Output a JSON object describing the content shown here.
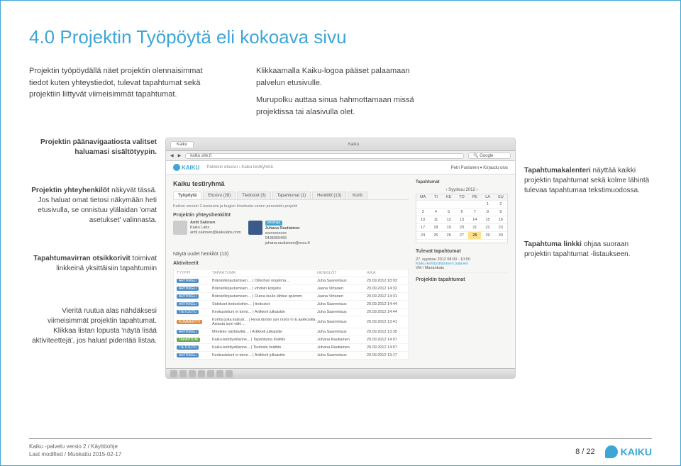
{
  "page": {
    "title": "4.0 Projektin Työpöytä eli kokoava sivu",
    "intro_left": "Projektin työpöydällä näet projektin olennaisimmat tiedot kuten yhteystiedot, tulevat tapahtumat sekä projektiin liittyvät viimeisimmät tapahtumat.",
    "intro_right1": "Klikkaamalla Kaiku-logoa pääset palaamaan palvelun etusivulle.",
    "intro_right2": "Murupolku auttaa sinua hahmottamaan missä projektissa tai alasivulla olet."
  },
  "notes": {
    "left1": "Projektin päänavigaatiosta valitset haluamasi sisältötyypin.",
    "left2_b": "Projektin yhteyhenkilöt",
    "left2": " näkyvät tässä. Jos haluat omat tietosi näkymään heti etusivulla, se onnistuu ylälaidan 'omat asetukset' valinnasta.",
    "left3_b": "Tapahtumavirran otsikkorivit",
    "left3": " toimivat linkkeinä yksittäisiin tapahtumiin",
    "left4": "Vieritä ruutua alas nähdäksesi viimeisimmät projektin tapahtumat. Klikkaa listan lopusta 'näytä lisää aktiviteettejä', jos haluat pidentää listaa.",
    "right1_b": "Tapahtumakalenteri",
    "right1": " näyttää kaikki projektin tapahtumat sekä kolme lähintä tulevaa tapahtumaa tekstimuodossa.",
    "right2_b": "Tapahtuma linkki",
    "right2": " ohjaa suoraan projektin tapahtumat -listaukseen."
  },
  "screenshot": {
    "tab_label": "Kaiku",
    "page_label": "Kaiku",
    "url": "kaiku.site.fi",
    "brand": "KAIKU",
    "breadcrumb": "Palvelun etusivu  ›  Kaiku testiryhmä",
    "user": "Petri Puolanen ▾   Kirjaudu ulos",
    "project_title": "Kaiku testiryhmä",
    "tabs": [
      "Työpöytä",
      "Etusivu (28)",
      "Tiedostot (3)",
      "Tapahtumat (1)",
      "Henkilöt (13)",
      "Kortit"
    ],
    "intro_text": "Kaikun version 2 testausta ja bugien ilmoitusta varten perustettu projekti",
    "section_contacts": "Projektin yhteyshenkilöt",
    "person1": {
      "name": "Antti Salonen",
      "org": "Kaiku Labs",
      "email": "antti.salonen@kaikulabs.com"
    },
    "person2": {
      "badge": "omistaja",
      "name": "Juhana Rautiainen",
      "org": "xxxxxxxxxxx",
      "phone": "0438365456",
      "email": "juhana.rautiainen@xxxx.fi"
    },
    "section_recent": "Näytä uudet henkilöt (13)",
    "section_activity": "Aktiviteetit",
    "act_headers": [
      "TYYPPI",
      "TAPAHTUMA",
      "HENKILÖT",
      "AIKA"
    ],
    "activities": [
      {
        "tag": "ARTIKKELI",
        "cls": "blue",
        "text": "Bränkirkirjautumisen… | Olikohan ongelma ...",
        "who": "Juha Saarentaus",
        "when": "20.09.2012 18:03"
      },
      {
        "tag": "ARTIKKELI",
        "cls": "blue",
        "text": "Bränkirkirjautumisen… | vihdoin korjattu",
        "who": "Jaana Virtanen",
        "when": "20.09.2012 14:32"
      },
      {
        "tag": "ARTIKKELI",
        "cls": "blue",
        "text": "Bränkirkirjautumisen… | Outoa kuule lähtee spämmi",
        "who": "Jaana Virtanen",
        "when": "20.09.2012 14:31"
      },
      {
        "tag": "ARTIKKELI",
        "cls": "blue",
        "text": "Sidokset tiedostoihin… | tiedostot",
        "who": "Juha Saarentaus",
        "when": "20.09.2012 14:44"
      },
      {
        "tag": "TIETOGTO",
        "cls": "blue",
        "text": "Keskusteluni ei toimi… | Artikkeli julkaistiin",
        "who": "Juha Saarentaus",
        "when": "20.09.2012 14:44"
      },
      {
        "tag": "KOMMENTTI",
        "cls": "orange",
        "text": "Korttia joita lisätud… | Hyvä tämän syn myös © & aakkosilla. Asiasta ison väki ...",
        "who": "Juha Saarentaus",
        "when": "20.09.2012 13:41"
      },
      {
        "tag": "ARTIKKELI",
        "cls": "blue",
        "text": "Mireikko näyttävillä… | Artikkeli julkaistiin",
        "who": "Juha Saarentaus",
        "when": "20.09.2012 13:35"
      },
      {
        "tag": "TAPAHTUM",
        "cls": "green",
        "text": "Kaiku-kehitystilanne... | Tapahtuma lisättiin",
        "who": "Juhana Rautiainen",
        "when": "20.09.2012 14:07"
      },
      {
        "tag": "TIETOGTO",
        "cls": "blue",
        "text": "Kaiku-kehitystilanne... | Tiedosto lisättiin",
        "who": "Juhana Rautiainen",
        "when": "20.09.2012 14:07"
      },
      {
        "tag": "ARTIKKELI",
        "cls": "blue",
        "text": "Keskusteluni ei toimi… | Artikkeli julkaistiin",
        "who": "Juha Saarentaus",
        "when": "20.09.2012 13:17"
      }
    ],
    "side_events": "Tapahtumat",
    "side_month_nav": "‹   Syyskuu 2012   ›",
    "cal_days": [
      "MA",
      "TI",
      "KE",
      "TO",
      "PE",
      "LA",
      "SU"
    ],
    "cal_cells": [
      "",
      "",
      "",
      "",
      "",
      "1",
      "2",
      "3",
      "4",
      "5",
      "6",
      "7",
      "8",
      "9",
      "10",
      "11",
      "12",
      "13",
      "14",
      "15",
      "16",
      "17",
      "18",
      "19",
      "20",
      "21",
      "22",
      "23",
      "24",
      "25",
      "26",
      "27",
      "28",
      "29",
      "30",
      "",
      "",
      "",
      "",
      "",
      "",
      ""
    ],
    "cal_today_index": 32,
    "upcoming_h": "Tulevat tapahtumat",
    "upcoming": [
      {
        "date": "27. syyskuu 2012 08:00 - 10:00",
        "title": "Kaiku-kehitystilanteen palaveri",
        "loc": "VM / Mariankatu"
      }
    ],
    "upcoming_sub": "Projektin tapahtumat"
  },
  "footer": {
    "line1": "Kaiku -palvelu versio 2 / Käyttöohje",
    "line2": "Last modified / Muokattu 2015-02-17",
    "page": "8 / 22",
    "brand": "KAIKU"
  }
}
